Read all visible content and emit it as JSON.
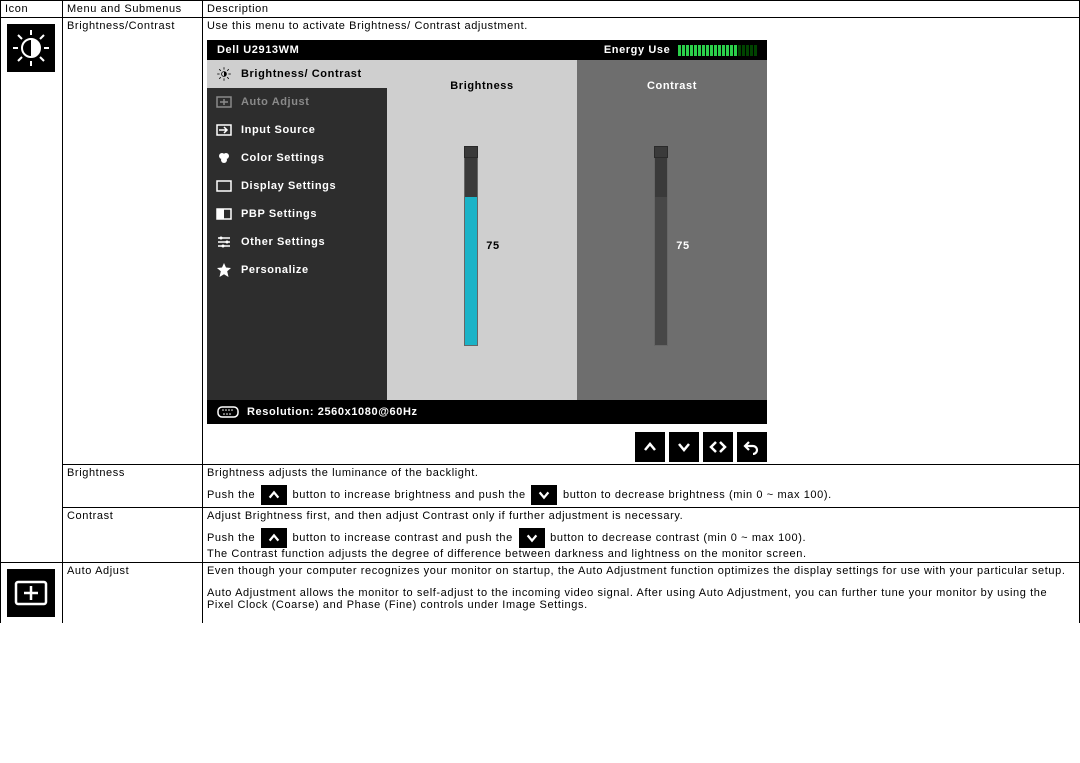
{
  "headers": {
    "icon": "Icon",
    "menu": "Menu and Submenus",
    "desc": "Description"
  },
  "rows": {
    "bc": {
      "menu": "Brightness/Contrast",
      "desc_intro": "Use this menu to activate Brightness/ Contrast adjustment."
    },
    "brightness": {
      "menu": "Brightness",
      "line1": "Brightness adjusts the luminance of the backlight.",
      "push_pre": "Push the ",
      "push_mid": " button to increase brightness and push the ",
      "push_post": " button to decrease brightness (min 0 ~ max 100)."
    },
    "contrast": {
      "menu": "Contrast",
      "line1": "Adjust Brightness first, and then adjust Contrast only if further adjustment is necessary.",
      "push_pre": "Push the ",
      "push_mid": " button to increase contrast and push the ",
      "push_post": " button to decrease contrast (min 0 ~ max 100).",
      "line3": "The Contrast function adjusts the degree of difference between darkness and lightness on the monitor screen."
    },
    "auto": {
      "menu": "Auto Adjust",
      "p1": "Even though your computer recognizes your monitor on startup, the Auto Adjustment function optimizes the display settings for use with your particular setup.",
      "p2": "Auto Adjustment allows the monitor to self-adjust to the incoming video signal. After using Auto Adjustment, you can further tune your monitor by using the Pixel Clock (Coarse) and Phase (Fine) controls under Image Settings."
    }
  },
  "osd": {
    "model": "Dell U2913WM",
    "energy_label": "Energy Use",
    "menu_items": [
      "Brightness/ Contrast",
      "Auto Adjust",
      "Input Source",
      "Color Settings",
      "Display Settings",
      "PBP Settings",
      "Other Settings",
      "Personalize"
    ],
    "brightness_label": "Brightness",
    "contrast_label": "Contrast",
    "brightness_value": "75",
    "contrast_value": "75",
    "resolution": "Resolution: 2560x1080@60Hz"
  }
}
